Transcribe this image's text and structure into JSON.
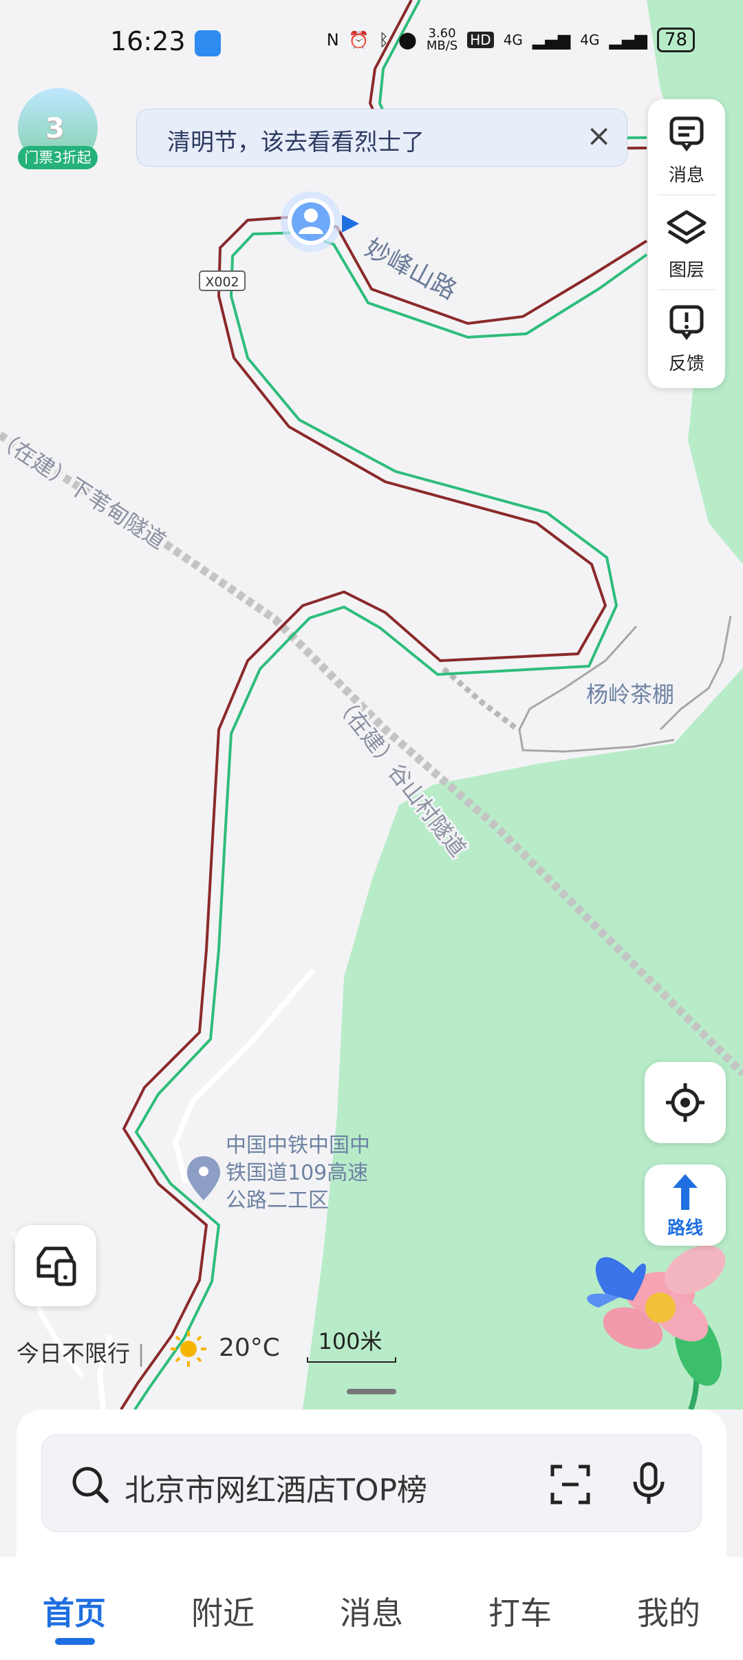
{
  "status_bar": {
    "time": "16:23",
    "speed": "3.60",
    "speed_unit": "MB/S",
    "hd_badge": "HD",
    "network_1": "4G",
    "network_2": "4G",
    "battery": "78",
    "icons": [
      "android-app-icon",
      "nfc-icon",
      "alarm-icon",
      "bluetooth-icon",
      "location-icon"
    ]
  },
  "promo": {
    "number": "3",
    "label": "门票3折起"
  },
  "banner": {
    "text": "清明节，该去看看烈士了",
    "close": "×"
  },
  "side_tools": [
    {
      "label": "消息",
      "icon": "message-icon"
    },
    {
      "label": "图层",
      "icon": "layers-icon"
    },
    {
      "label": "反馈",
      "icon": "feedback-icon"
    }
  ],
  "map": {
    "road_shield": "X002",
    "road_name": "妙峰山路",
    "tunnel_1": "（在建）下苇甸隧道",
    "tunnel_2": "（在建）谷山村隧道",
    "place_1": "杨岭茶棚",
    "poi_lines": [
      "中国中铁中国中",
      "铁国道109高速",
      "公路二工区"
    ],
    "colors": {
      "road_red": "#8b2a2a",
      "road_green": "#2ebd7b",
      "forest": "#b8ecc9",
      "ground": "#f3f3f5"
    }
  },
  "route_button": {
    "label": "路线"
  },
  "restriction": "今日不限行",
  "weather": {
    "temp": "20°C",
    "icon": "sun-icon"
  },
  "scale": "100米",
  "search": {
    "placeholder": "北京市网红酒店TOP榜"
  },
  "tabs": [
    {
      "label": "首页",
      "active": true
    },
    {
      "label": "附近",
      "active": false
    },
    {
      "label": "消息",
      "active": false
    },
    {
      "label": "打车",
      "active": false
    },
    {
      "label": "我的",
      "active": false
    }
  ]
}
